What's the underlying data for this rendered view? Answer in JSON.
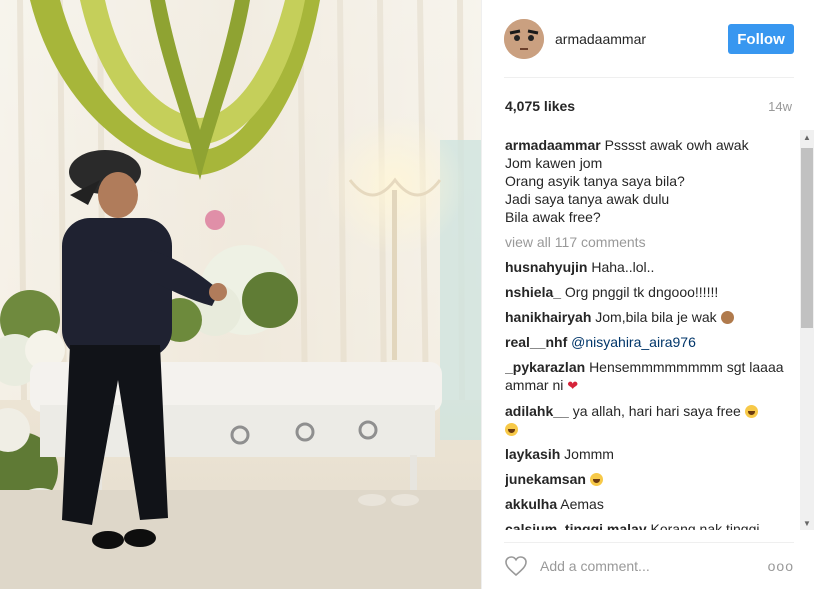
{
  "post": {
    "username": "armadaammar",
    "follow_label": "Follow",
    "likes": "4,075 likes",
    "time": "14w",
    "caption_user": "armadaammar",
    "caption_lines": [
      "Psssst awak owh awak",
      "Jom kawen jom",
      "Orang asyik tanya saya bila?",
      "Jadi saya tanya awak dulu",
      "Bila awak free?"
    ],
    "view_all": "view all 117 comments"
  },
  "comments": [
    {
      "user": "husnahyujin",
      "text": "Haha..lol.."
    },
    {
      "user": "nshiela_",
      "text": "Org pnggil tk dngooo!!!!!!"
    },
    {
      "user": "hanikhairyah",
      "text": "Jom,bila bila je wak"
    },
    {
      "user": "real__nhf",
      "text": "@nisyahira_aira976"
    },
    {
      "user": "_pykarazlan",
      "text": "Hensemmmmmmmm sgt laaaa ammar ni"
    },
    {
      "user": "adilahk__",
      "text": "ya allah, hari hari saya free"
    },
    {
      "user": "laykasih",
      "text": "Jommm"
    },
    {
      "user": "junekamsan",
      "text": ""
    },
    {
      "user": "akkulha",
      "text": "Aemas"
    },
    {
      "user": "calsium_tinggi.malay",
      "text": "Korang nak tinggi"
    }
  ],
  "footer": {
    "placeholder": "Add a comment...",
    "more": "ooo"
  },
  "colors": {
    "follow_button": "#3897f0",
    "mention": "#003569",
    "secondary_text": "#999999"
  },
  "icons": [
    "heart-outline-icon",
    "more-options-icon",
    "scroll-up-arrow-icon",
    "scroll-down-arrow-icon"
  ]
}
